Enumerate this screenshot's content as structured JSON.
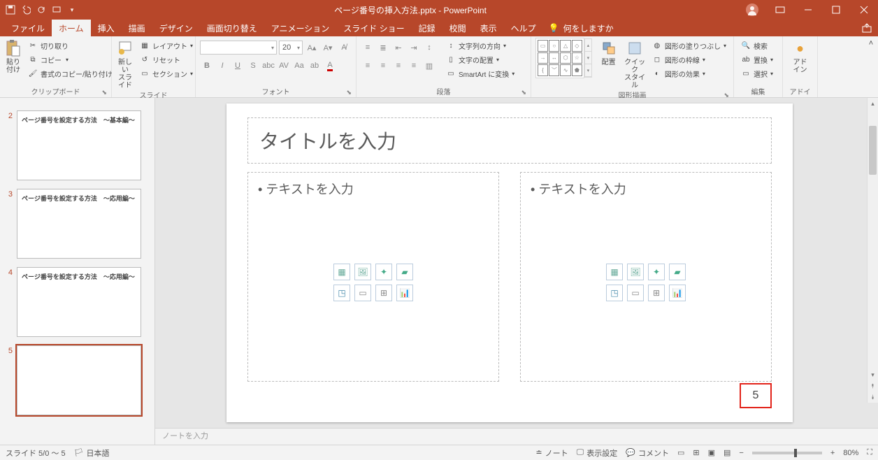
{
  "title": "ページ番号の挿入方法.pptx  -  PowerPoint",
  "tabs": {
    "file": "ファイル",
    "home": "ホーム",
    "insert": "挿入",
    "draw": "描画",
    "design": "デザイン",
    "transitions": "画面切り替え",
    "animations": "アニメーション",
    "slideshow": "スライド ショー",
    "record": "記録",
    "review": "校閲",
    "view": "表示",
    "help": "ヘルプ",
    "tellme": "何をしますか"
  },
  "ribbon": {
    "clipboard": {
      "paste": "貼り付け",
      "cut": "切り取り",
      "copy": "コピー",
      "format_painter": "書式のコピー/貼り付け",
      "label": "クリップボード"
    },
    "slides": {
      "new_slide": "新しい\nスライド",
      "layout": "レイアウト",
      "reset": "リセット",
      "section": "セクション",
      "label": "スライド"
    },
    "font": {
      "size": "20",
      "label": "フォント"
    },
    "paragraph": {
      "direction": "文字列の方向",
      "align": "文字の配置",
      "smartart": "SmartArt に変換",
      "label": "段落"
    },
    "drawing": {
      "arrange": "配置",
      "quick_styles": "クイック\nスタイル",
      "fill": "図形の塗りつぶし",
      "outline": "図形の枠線",
      "effects": "図形の効果",
      "label": "図形描画"
    },
    "editing": {
      "find": "検索",
      "replace": "置換",
      "select": "選択",
      "label": "編集"
    },
    "addins": {
      "label_btn": "アド\nイン",
      "label": "アドイン"
    }
  },
  "thumbs": [
    {
      "num": "",
      "title": ""
    },
    {
      "num": "2",
      "title": "ページ番号を設定する方法　～基本編～"
    },
    {
      "num": "3",
      "title": "ページ番号を設定する方法　～応用編～"
    },
    {
      "num": "4",
      "title": "ページ番号を設定する方法　～応用編～"
    },
    {
      "num": "5",
      "title": ""
    }
  ],
  "slide": {
    "title_ph": "タイトルを入力",
    "body_ph": "テキストを入力",
    "page_number": "5"
  },
  "notes_ph": "ノートを入力",
  "status": {
    "slide_indicator": "スライド 5/0 ～ 5",
    "language": "日本語",
    "notes": "ノート",
    "display": "表示設定",
    "comments": "コメント",
    "zoom": "80%"
  }
}
